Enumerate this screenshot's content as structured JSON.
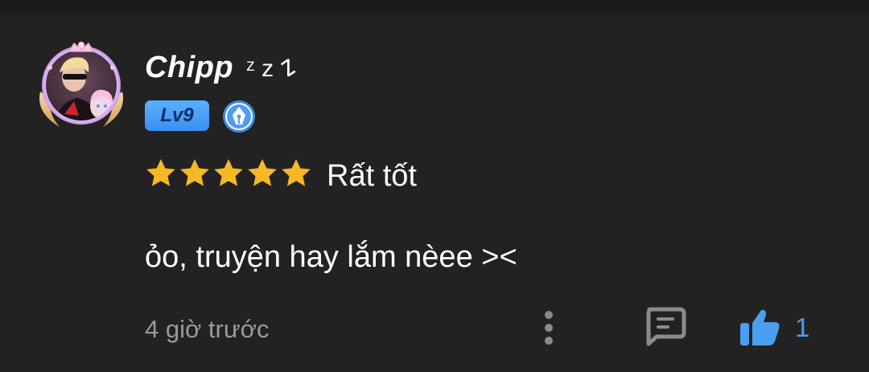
{
  "comment": {
    "username": "Chipp",
    "username_suffix": "ᶻ z 𐰁",
    "level_badge": "Lv9",
    "rating": {
      "stars": 5,
      "max": 5,
      "label": "Rất tốt"
    },
    "text": "ỏo, truyện hay lắm nèee ><",
    "timestamp": "4 giờ trước",
    "like_count": "1"
  },
  "icons": {
    "avatar": "avatar-with-crown-frame",
    "level": "level-badge",
    "writer": "pen-nib-icon",
    "more": "more-vertical-icon",
    "reply": "comment-icon",
    "like": "thumbs-up-icon"
  },
  "colors": {
    "background": "#222222",
    "star": "#f7b825",
    "accent_blue": "#4a9ff0",
    "muted_text": "#9a9a9a",
    "icon_grey": "#8c8c8c"
  }
}
